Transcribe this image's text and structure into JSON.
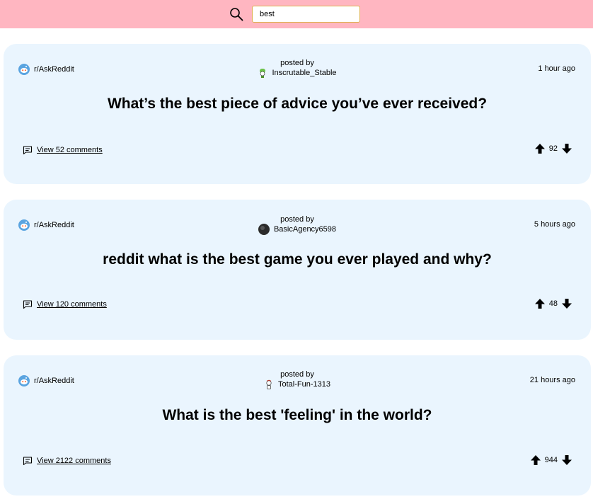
{
  "search": {
    "value": "best",
    "icon": "search-icon"
  },
  "posts": [
    {
      "subreddit": "r/AskReddit",
      "posted_by_label": "posted by",
      "author": "Inscrutable_Stable",
      "time": "1 hour ago",
      "title": "What’s the best piece of advice you’ve ever received?",
      "comments_label": "View 52 comments",
      "votes": "92"
    },
    {
      "subreddit": "r/AskReddit",
      "posted_by_label": "posted by",
      "author": "BasicAgency6598",
      "time": "5 hours ago",
      "title": "reddit what is the best game you ever played and why?",
      "comments_label": "View 120 comments",
      "votes": "48"
    },
    {
      "subreddit": "r/AskReddit",
      "posted_by_label": "posted by",
      "author": "Total-Fun-1313",
      "time": "21 hours ago",
      "title": "What is the best 'feeling' in the world?",
      "comments_label": "View 2122 comments",
      "votes": "944"
    }
  ],
  "colors": {
    "header_bg": "#ffb6c1",
    "card_bg": "#eaf5fe",
    "input_border": "#e0b050"
  }
}
